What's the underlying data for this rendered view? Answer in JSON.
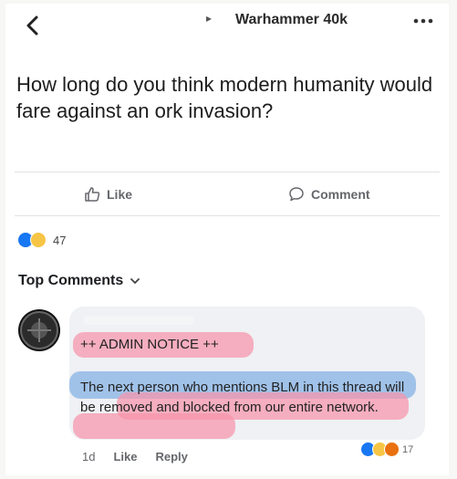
{
  "header": {
    "group_name": "Warhammer 40k",
    "colors": {
      "text": "#2a2a2a"
    }
  },
  "post": {
    "question": "How long do you think modern humanity would fare against an ork invasion?",
    "like_label": "Like",
    "comment_label": "Comment",
    "reaction_count": "47"
  },
  "comments": {
    "section_label": "Top Comments",
    "items": [
      {
        "title": "++ ADMIN NOTICE ++",
        "body": "The next person who mentions BLM in this thread will be removed and blocked from our entire network.",
        "time": "1d",
        "like_label": "Like",
        "reply_label": "Reply",
        "reaction_count": "17"
      }
    ]
  },
  "colors": {
    "like_blue": "#1877f2",
    "haha_yellow": "#f7c545",
    "angry_red": "#e9710f",
    "highlight_pink": "#f694aa",
    "highlight_blue": "#85b2e6",
    "muted_text": "#65676b"
  },
  "icons": [
    "back-icon",
    "more-icon",
    "like-icon",
    "comment-icon",
    "chevron-down-icon"
  ]
}
